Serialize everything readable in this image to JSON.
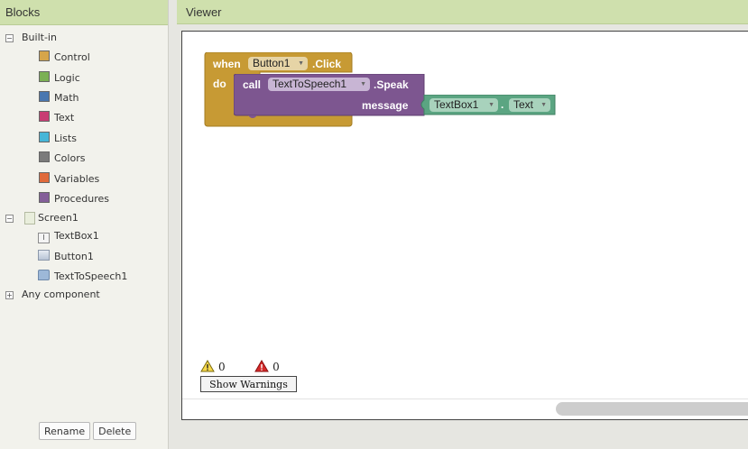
{
  "blocks_panel": {
    "title": "Blocks",
    "builtin": {
      "label": "Built-in",
      "toggle": "−",
      "items": [
        {
          "label": "Control",
          "color": "#d6a54a"
        },
        {
          "label": "Logic",
          "color": "#7bb054"
        },
        {
          "label": "Math",
          "color": "#4a77b0"
        },
        {
          "label": "Text",
          "color": "#c83c73"
        },
        {
          "label": "Lists",
          "color": "#47b6d8"
        },
        {
          "label": "Colors",
          "color": "#7b7b7b"
        },
        {
          "label": "Variables",
          "color": "#e06a3b"
        },
        {
          "label": "Procedures",
          "color": "#845f99"
        }
      ]
    },
    "screen": {
      "label": "Screen1",
      "toggle": "−",
      "components": [
        {
          "label": "TextBox1",
          "icon": "textbox-icon"
        },
        {
          "label": "Button1",
          "icon": "button-icon"
        },
        {
          "label": "TextToSpeech1",
          "icon": "speech-icon"
        }
      ]
    },
    "any_component": {
      "label": "Any component",
      "toggle": "+"
    },
    "rename_label": "Rename",
    "delete_label": "Delete"
  },
  "viewer": {
    "title": "Viewer",
    "event_block": {
      "when_label": "when",
      "component": "Button1",
      "event": ".Click",
      "do_label": "do",
      "color": "#c79a34"
    },
    "call_block": {
      "call_label": "call",
      "component": "TextToSpeech1",
      "method": ".Speak",
      "param_label": "message",
      "color": "#7d5690"
    },
    "getter_block": {
      "component": "TextBox1",
      "dot": ".",
      "property": "Text",
      "color": "#5ba582"
    },
    "warnings": {
      "count": "0",
      "errors": "0",
      "button_label": "Show Warnings"
    }
  }
}
